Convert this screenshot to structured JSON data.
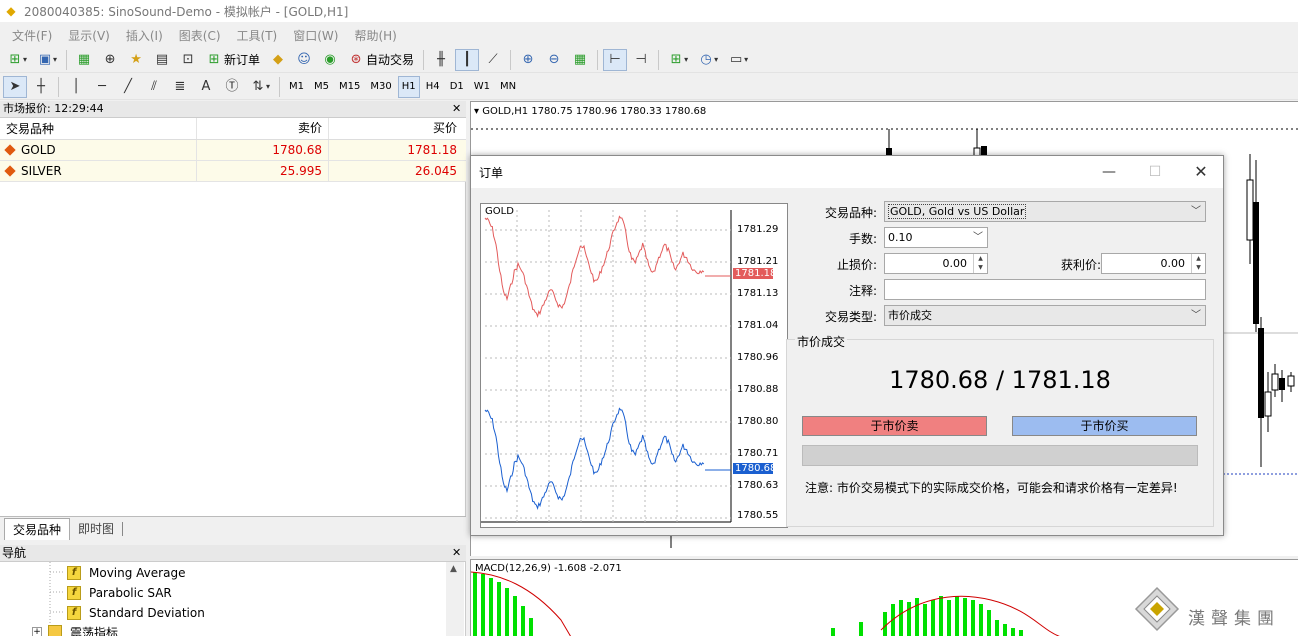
{
  "window": {
    "title": "2080040385: SinoSound-Demo - 模拟帐户 - [GOLD,H1]"
  },
  "menu": [
    "文件(F)",
    "显示(V)",
    "插入(I)",
    "图表(C)",
    "工具(T)",
    "窗口(W)",
    "帮助(H)"
  ],
  "toolbar": {
    "new_order": "新订单",
    "auto_trade": "自动交易",
    "periods": [
      "M1",
      "M5",
      "M15",
      "M30",
      "H1",
      "H4",
      "D1",
      "W1",
      "MN"
    ],
    "active_period": "H1",
    "text_tool": "A"
  },
  "market_watch": {
    "title": "市场报价: 12:29:44",
    "columns": [
      "交易品种",
      "卖价",
      "买价"
    ],
    "rows": [
      {
        "symbol": "GOLD",
        "bid": "1780.68",
        "ask": "1781.18"
      },
      {
        "symbol": "SILVER",
        "bid": "25.995",
        "ask": "26.045"
      }
    ],
    "tabs": [
      "交易品种",
      "即时图"
    ]
  },
  "navigator": {
    "title": "导航",
    "items": [
      "Moving Average",
      "Parabolic SAR",
      "Standard Deviation",
      "震荡指标"
    ]
  },
  "chart": {
    "label": "GOLD,H1  1780.75 1780.96 1780.33 1780.68",
    "macd_label": "MACD(12,26,9) -1.608 -2.071"
  },
  "order_dialog": {
    "title": "订单",
    "mini_chart": {
      "symbol": "GOLD",
      "price_labels": [
        "1781.29",
        "1781.21",
        "1781.13",
        "1781.04",
        "1780.96",
        "1780.88",
        "1780.80",
        "1780.71",
        "1780.63",
        "1780.55"
      ],
      "ask_label": "1781.18",
      "bid_label": "1780.68",
      "ask_color": "#e35b5b",
      "bid_color": "#1a5fd0"
    },
    "labels": {
      "symbol": "交易品种:",
      "volume": "手数:",
      "stop_loss": "止损价:",
      "take_profit": "获利价:",
      "comment": "注释:",
      "type": "交易类型:"
    },
    "values": {
      "symbol": "GOLD, Gold vs US Dollar",
      "volume": "0.10",
      "stop_loss": "0.00",
      "take_profit": "0.00",
      "comment": "",
      "type": "市价成交"
    },
    "market_section": {
      "title": "市价成交",
      "price": "1780.68 / 1781.18",
      "sell_label": "于市价卖",
      "buy_label": "于市价买",
      "sell_color": "#f08080",
      "buy_color": "#9cbcf0",
      "note": "注意: 市价交易模式下的实际成交价格，可能会和请求价格有一定差异!"
    }
  },
  "watermark": {
    "text": "漢聲集團"
  }
}
